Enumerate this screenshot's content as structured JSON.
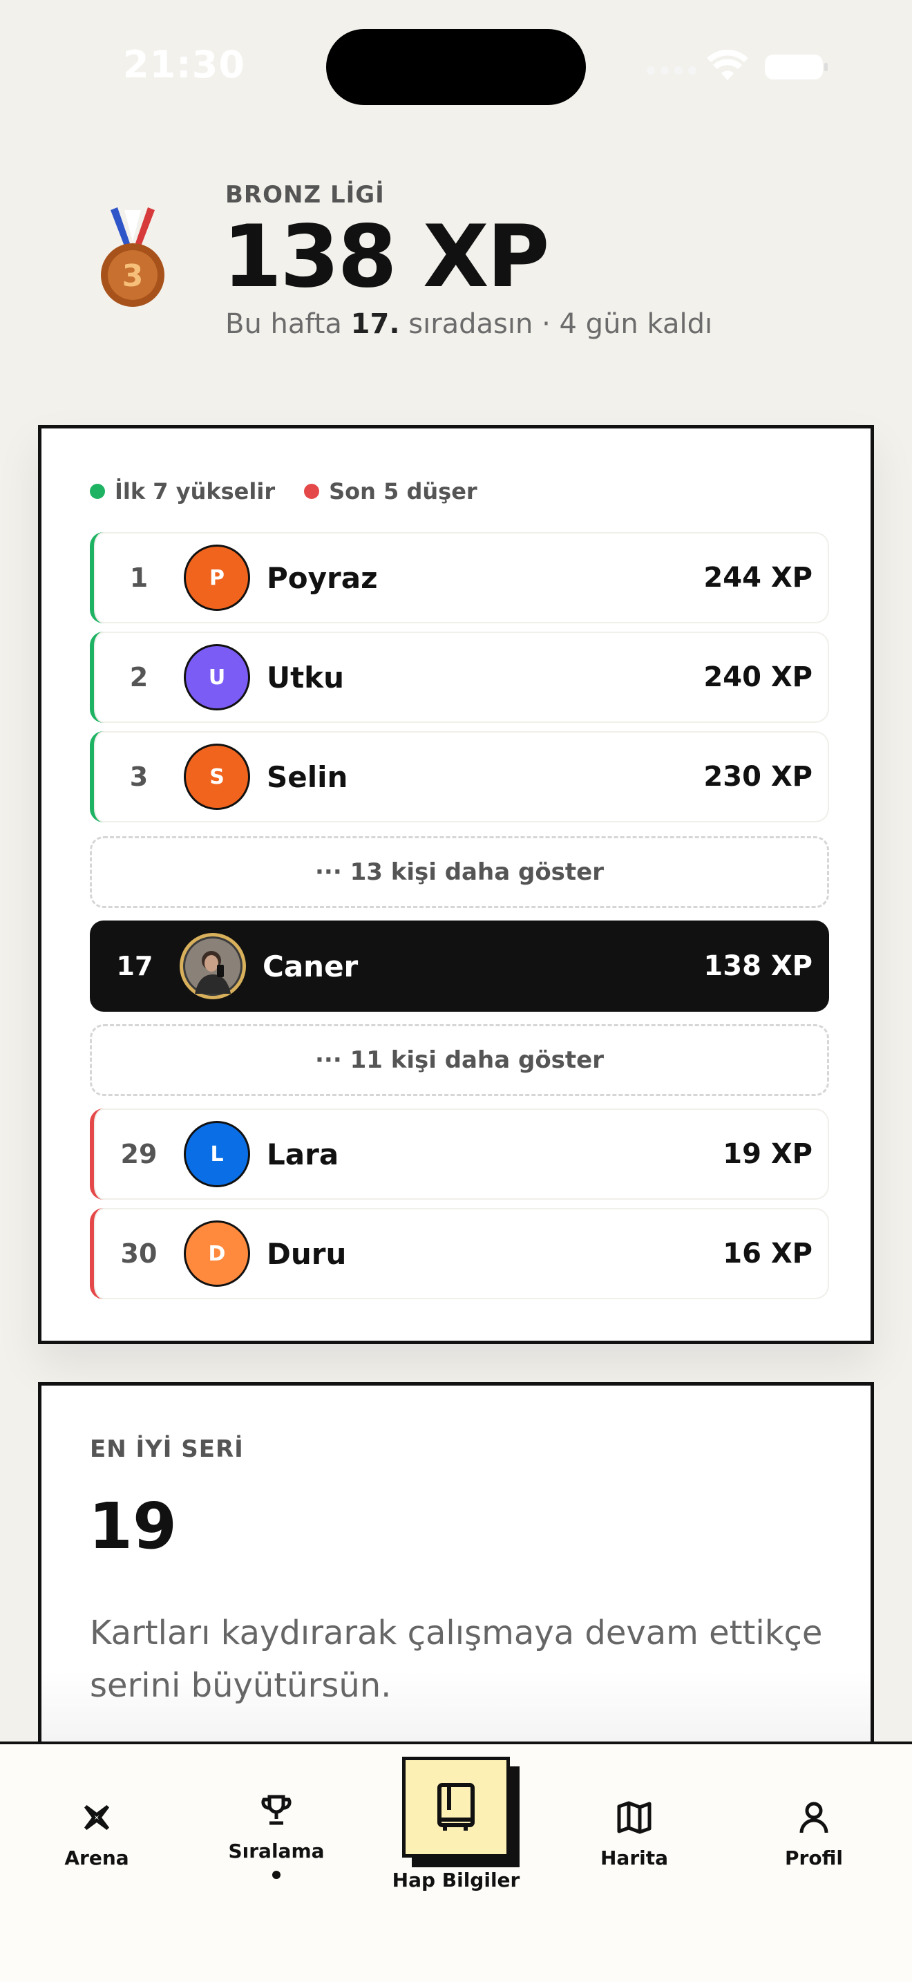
{
  "status": {
    "time": "21:30"
  },
  "header": {
    "league": "BRONZ LİGİ",
    "xp": "138 XP",
    "week_prefix": "Bu hafta ",
    "week_rank": "17.",
    "week_suffix": " sıradasın · 4 gün kaldı",
    "medal_number": "3"
  },
  "legend": {
    "promote": "İlk 7 yükselir",
    "relegate": "Son 5 düşer"
  },
  "leaderboard": {
    "top": [
      {
        "rank": "1",
        "initial": "P",
        "name": "Poyraz",
        "xp": "244 XP",
        "color": "#f0641e"
      },
      {
        "rank": "2",
        "initial": "U",
        "name": "Utku",
        "xp": "240 XP",
        "color": "#7b5cf5"
      },
      {
        "rank": "3",
        "initial": "S",
        "name": "Selin",
        "xp": "230 XP",
        "color": "#f0641e"
      }
    ],
    "more_top": "··· 13 kişi daha göster",
    "me": {
      "rank": "17",
      "name": "Caner",
      "xp": "138 XP"
    },
    "more_bottom": "··· 11 kişi daha göster",
    "bottom": [
      {
        "rank": "29",
        "initial": "L",
        "name": "Lara",
        "xp": "19 XP",
        "color": "#0a6fe6"
      },
      {
        "rank": "30",
        "initial": "D",
        "name": "Duru",
        "xp": "16 XP",
        "color": "#ff8a3d"
      }
    ]
  },
  "streak": {
    "label": "EN İYİ SERİ",
    "value": "19",
    "text": "Kartları kaydırarak çalışmaya devam ettikçe serini büyütürsün."
  },
  "nav": {
    "arena": "Arena",
    "ranking": "Sıralama",
    "center": "Hap Bilgiler",
    "map": "Harita",
    "profile": "Profil"
  },
  "colors": {
    "green": "#1eb362",
    "red": "#e54848",
    "accent_yellow": "#fdf0b5"
  }
}
